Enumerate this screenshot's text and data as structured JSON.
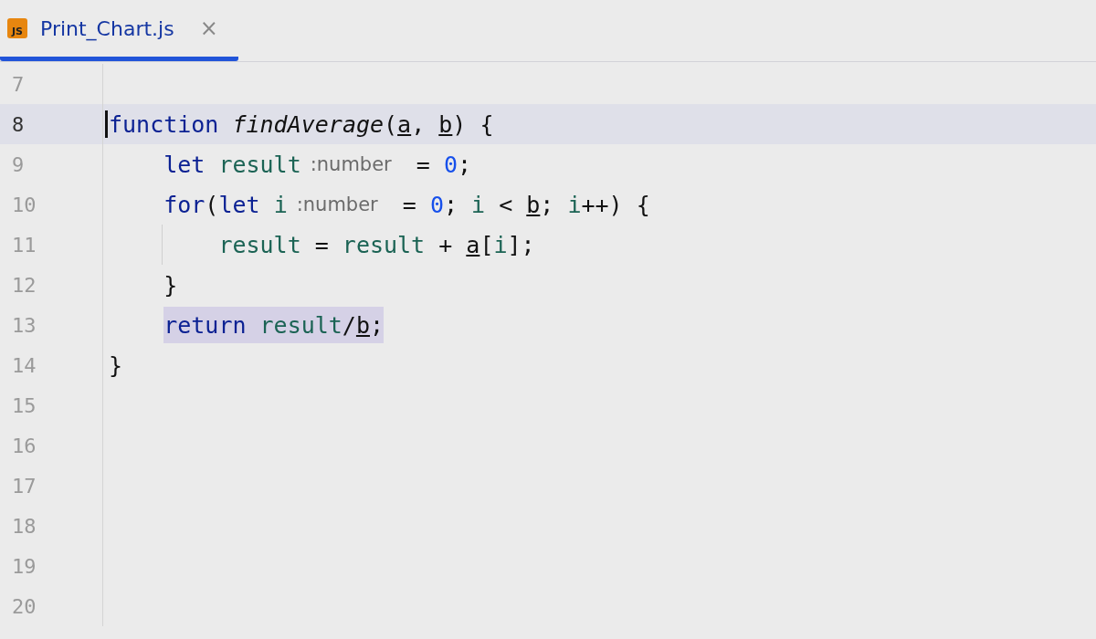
{
  "tabs": [
    {
      "icon": "JS",
      "title": "Print_Chart.js",
      "close": "×",
      "selected": true
    }
  ],
  "lines": [
    {
      "number": "7",
      "current": false
    },
    {
      "number": "8",
      "current": true,
      "tokens": [
        {
          "kind": "keyword",
          "text": "function "
        },
        {
          "kind": "function",
          "text": "findAverage"
        },
        {
          "kind": "punct",
          "text": "("
        },
        {
          "kind": "param",
          "text": "a"
        },
        {
          "kind": "punct",
          "text": ", "
        },
        {
          "kind": "param",
          "text": "b"
        },
        {
          "kind": "punct",
          "text": ") {"
        }
      ],
      "children": [
        {
          "number": "9",
          "current": false,
          "tokens": [
            {
              "kind": "keyword",
              "text": "let "
            },
            {
              "kind": "variable",
              "text": "result"
            },
            {
              "kind": "hint",
              "text": ":number"
            },
            {
              "kind": "punct",
              "text": " = "
            },
            {
              "kind": "number",
              "text": "0"
            },
            {
              "kind": "punct",
              "text": ";"
            }
          ]
        },
        {
          "number": "10",
          "current": false,
          "tokens": [
            {
              "kind": "keyword",
              "text": "for"
            },
            {
              "kind": "punct",
              "text": "("
            },
            {
              "kind": "keyword",
              "text": "let "
            },
            {
              "kind": "variable",
              "text": "i"
            },
            {
              "kind": "hint",
              "text": ":number"
            },
            {
              "kind": "punct",
              "text": " = "
            },
            {
              "kind": "number",
              "text": "0"
            },
            {
              "kind": "punct",
              "text": "; "
            },
            {
              "kind": "variable",
              "text": "i"
            },
            {
              "kind": "punct",
              "text": " < "
            },
            {
              "kind": "param",
              "text": "b"
            },
            {
              "kind": "punct",
              "text": "; "
            },
            {
              "kind": "variable",
              "text": "i"
            },
            {
              "kind": "punct",
              "text": "++) {"
            }
          ],
          "children": [
            {
              "number": "11",
              "current": false,
              "guide": true,
              "tokens": [
                {
                  "kind": "variable",
                  "text": "result"
                },
                {
                  "kind": "punct",
                  "text": " = "
                },
                {
                  "kind": "variable",
                  "text": "result"
                },
                {
                  "kind": "punct",
                  "text": " + "
                },
                {
                  "kind": "param",
                  "text": "a"
                },
                {
                  "kind": "punct",
                  "text": "["
                },
                {
                  "kind": "variable",
                  "text": "i"
                },
                {
                  "kind": "punct",
                  "text": "];"
                }
              ]
            }
          ]
        },
        {
          "number": "12",
          "current": false,
          "tokens": [
            {
              "kind": "punct",
              "text": "}"
            }
          ]
        },
        {
          "number": "13",
          "current": false,
          "highlighted": true,
          "tokens": [
            {
              "kind": "keyword",
              "text": "return "
            },
            {
              "kind": "variable",
              "text": "result"
            },
            {
              "kind": "punct",
              "text": "/"
            },
            {
              "kind": "param",
              "text": "b"
            },
            {
              "kind": "punct",
              "text": ";"
            }
          ]
        }
      ]
    },
    {
      "number": "14",
      "current": false,
      "tokens": [
        {
          "kind": "punct",
          "text": "}"
        }
      ]
    },
    {
      "number": "15",
      "current": false
    },
    {
      "number": "16",
      "current": false
    },
    {
      "number": "17",
      "current": false
    },
    {
      "number": "18",
      "current": false
    },
    {
      "number": "19",
      "current": false
    },
    {
      "number": "20",
      "current": false
    }
  ]
}
